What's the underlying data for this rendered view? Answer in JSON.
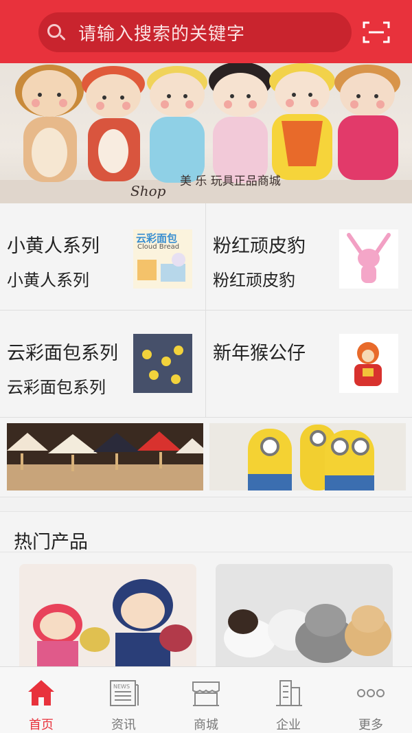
{
  "search": {
    "placeholder": "请输入搜索的关键字"
  },
  "banner": {
    "caption_script": "Shop",
    "caption_text": "美 乐 玩具正品商城"
  },
  "categories": [
    {
      "title": "小黄人系列",
      "subtitle": "小黄人系列",
      "thumb_text": "云彩面包",
      "thumb_sub": "Cloud Bread"
    },
    {
      "title": "粉红顽皮豹",
      "subtitle": "粉红顽皮豹"
    },
    {
      "title": "云彩面包系列",
      "subtitle": "云彩面包系列"
    },
    {
      "title": "新年猴公仔",
      "subtitle": ""
    }
  ],
  "hot": {
    "title": "热门产品"
  },
  "tabs": [
    {
      "label": "首页",
      "icon": "home-icon",
      "active": true
    },
    {
      "label": "资讯",
      "icon": "news-icon",
      "icon_text": "NEWS"
    },
    {
      "label": "商城",
      "icon": "store-icon"
    },
    {
      "label": "企业",
      "icon": "building-icon"
    },
    {
      "label": "更多",
      "icon": "more-icon"
    }
  ],
  "colors": {
    "accent": "#e8323c",
    "search_bg": "#c9242e"
  }
}
